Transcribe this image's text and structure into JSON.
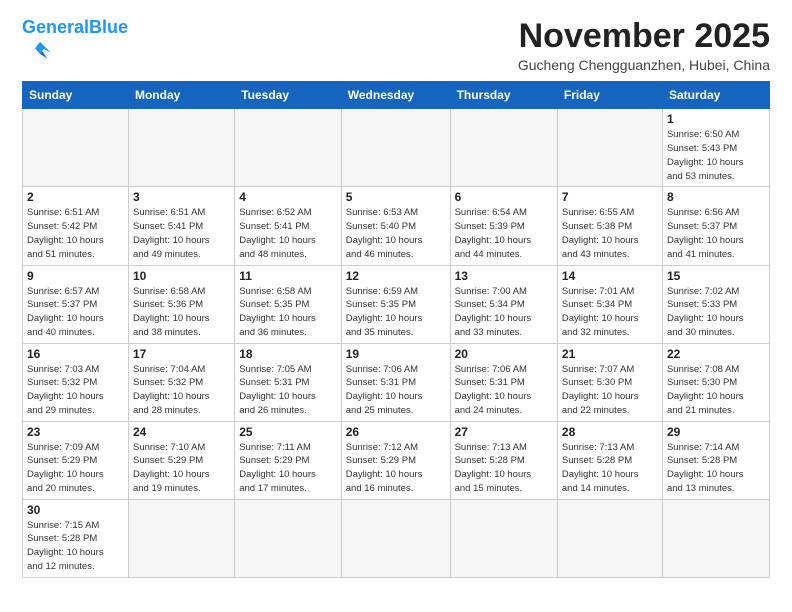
{
  "header": {
    "logo_general": "General",
    "logo_blue": "Blue",
    "month_title": "November 2025",
    "subtitle": "Gucheng Chengguanzhen, Hubei, China"
  },
  "weekdays": [
    "Sunday",
    "Monday",
    "Tuesday",
    "Wednesday",
    "Thursday",
    "Friday",
    "Saturday"
  ],
  "days": [
    {
      "num": "",
      "info": ""
    },
    {
      "num": "",
      "info": ""
    },
    {
      "num": "",
      "info": ""
    },
    {
      "num": "",
      "info": ""
    },
    {
      "num": "",
      "info": ""
    },
    {
      "num": "",
      "info": ""
    },
    {
      "num": "1",
      "info": "Sunrise: 6:50 AM\nSunset: 5:43 PM\nDaylight: 10 hours\nand 53 minutes."
    },
    {
      "num": "2",
      "info": "Sunrise: 6:51 AM\nSunset: 5:42 PM\nDaylight: 10 hours\nand 51 minutes."
    },
    {
      "num": "3",
      "info": "Sunrise: 6:51 AM\nSunset: 5:41 PM\nDaylight: 10 hours\nand 49 minutes."
    },
    {
      "num": "4",
      "info": "Sunrise: 6:52 AM\nSunset: 5:41 PM\nDaylight: 10 hours\nand 48 minutes."
    },
    {
      "num": "5",
      "info": "Sunrise: 6:53 AM\nSunset: 5:40 PM\nDaylight: 10 hours\nand 46 minutes."
    },
    {
      "num": "6",
      "info": "Sunrise: 6:54 AM\nSunset: 5:39 PM\nDaylight: 10 hours\nand 44 minutes."
    },
    {
      "num": "7",
      "info": "Sunrise: 6:55 AM\nSunset: 5:38 PM\nDaylight: 10 hours\nand 43 minutes."
    },
    {
      "num": "8",
      "info": "Sunrise: 6:56 AM\nSunset: 5:37 PM\nDaylight: 10 hours\nand 41 minutes."
    },
    {
      "num": "9",
      "info": "Sunrise: 6:57 AM\nSunset: 5:37 PM\nDaylight: 10 hours\nand 40 minutes."
    },
    {
      "num": "10",
      "info": "Sunrise: 6:58 AM\nSunset: 5:36 PM\nDaylight: 10 hours\nand 38 minutes."
    },
    {
      "num": "11",
      "info": "Sunrise: 6:58 AM\nSunset: 5:35 PM\nDaylight: 10 hours\nand 36 minutes."
    },
    {
      "num": "12",
      "info": "Sunrise: 6:59 AM\nSunset: 5:35 PM\nDaylight: 10 hours\nand 35 minutes."
    },
    {
      "num": "13",
      "info": "Sunrise: 7:00 AM\nSunset: 5:34 PM\nDaylight: 10 hours\nand 33 minutes."
    },
    {
      "num": "14",
      "info": "Sunrise: 7:01 AM\nSunset: 5:34 PM\nDaylight: 10 hours\nand 32 minutes."
    },
    {
      "num": "15",
      "info": "Sunrise: 7:02 AM\nSunset: 5:33 PM\nDaylight: 10 hours\nand 30 minutes."
    },
    {
      "num": "16",
      "info": "Sunrise: 7:03 AM\nSunset: 5:32 PM\nDaylight: 10 hours\nand 29 minutes."
    },
    {
      "num": "17",
      "info": "Sunrise: 7:04 AM\nSunset: 5:32 PM\nDaylight: 10 hours\nand 28 minutes."
    },
    {
      "num": "18",
      "info": "Sunrise: 7:05 AM\nSunset: 5:31 PM\nDaylight: 10 hours\nand 26 minutes."
    },
    {
      "num": "19",
      "info": "Sunrise: 7:06 AM\nSunset: 5:31 PM\nDaylight: 10 hours\nand 25 minutes."
    },
    {
      "num": "20",
      "info": "Sunrise: 7:06 AM\nSunset: 5:31 PM\nDaylight: 10 hours\nand 24 minutes."
    },
    {
      "num": "21",
      "info": "Sunrise: 7:07 AM\nSunset: 5:30 PM\nDaylight: 10 hours\nand 22 minutes."
    },
    {
      "num": "22",
      "info": "Sunrise: 7:08 AM\nSunset: 5:30 PM\nDaylight: 10 hours\nand 21 minutes."
    },
    {
      "num": "23",
      "info": "Sunrise: 7:09 AM\nSunset: 5:29 PM\nDaylight: 10 hours\nand 20 minutes."
    },
    {
      "num": "24",
      "info": "Sunrise: 7:10 AM\nSunset: 5:29 PM\nDaylight: 10 hours\nand 19 minutes."
    },
    {
      "num": "25",
      "info": "Sunrise: 7:11 AM\nSunset: 5:29 PM\nDaylight: 10 hours\nand 17 minutes."
    },
    {
      "num": "26",
      "info": "Sunrise: 7:12 AM\nSunset: 5:29 PM\nDaylight: 10 hours\nand 16 minutes."
    },
    {
      "num": "27",
      "info": "Sunrise: 7:13 AM\nSunset: 5:28 PM\nDaylight: 10 hours\nand 15 minutes."
    },
    {
      "num": "28",
      "info": "Sunrise: 7:13 AM\nSunset: 5:28 PM\nDaylight: 10 hours\nand 14 minutes."
    },
    {
      "num": "29",
      "info": "Sunrise: 7:14 AM\nSunset: 5:28 PM\nDaylight: 10 hours\nand 13 minutes."
    },
    {
      "num": "30",
      "info": "Sunrise: 7:15 AM\nSunset: 5:28 PM\nDaylight: 10 hours\nand 12 minutes."
    },
    {
      "num": "",
      "info": ""
    },
    {
      "num": "",
      "info": ""
    },
    {
      "num": "",
      "info": ""
    },
    {
      "num": "",
      "info": ""
    },
    {
      "num": "",
      "info": ""
    },
    {
      "num": "",
      "info": ""
    }
  ]
}
